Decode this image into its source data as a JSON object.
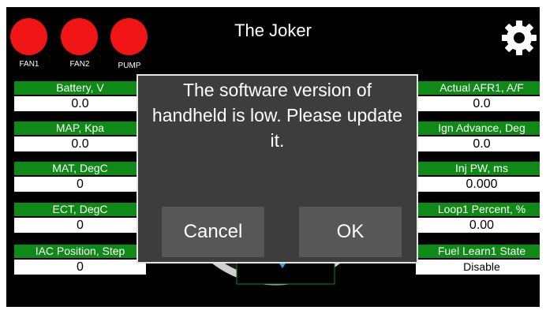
{
  "app": {
    "title": "The Joker"
  },
  "indicators": [
    {
      "label": "FAN1",
      "color": "#f01414"
    },
    {
      "label": "FAN2",
      "color": "#f01414"
    },
    {
      "label": "PUMP",
      "color": "#f01414"
    }
  ],
  "left_gauges": [
    {
      "label": "Battery, V",
      "value": "0.0"
    },
    {
      "label": "MAP, Kpa",
      "value": "0.0"
    },
    {
      "label": "MAT, DegC",
      "value": "0"
    },
    {
      "label": "ECT, DegC",
      "value": "0"
    },
    {
      "label": "IAC Position, Step",
      "value": "0"
    }
  ],
  "right_gauges": [
    {
      "label": "Actual AFR1, A/F",
      "value": "0.0"
    },
    {
      "label": "Ign Advance, Deg",
      "value": "0.0"
    },
    {
      "label": "Inj PW, ms",
      "value": "0.000"
    },
    {
      "label": "Loop1 Percent, %",
      "value": "0.00"
    },
    {
      "label": "Fuel Learn1 State",
      "value": "Disable"
    }
  ],
  "dialog": {
    "message": "The software version of handheld is low. Please update it.",
    "cancel_label": "Cancel",
    "ok_label": "OK"
  },
  "icons": {
    "settings": "gear-icon"
  },
  "colors": {
    "background": "#000000",
    "gauge_label": "#0f8a17",
    "indicator": "#f01414",
    "dialog_bg": "#3d3d3d",
    "button_bg": "#575757"
  }
}
